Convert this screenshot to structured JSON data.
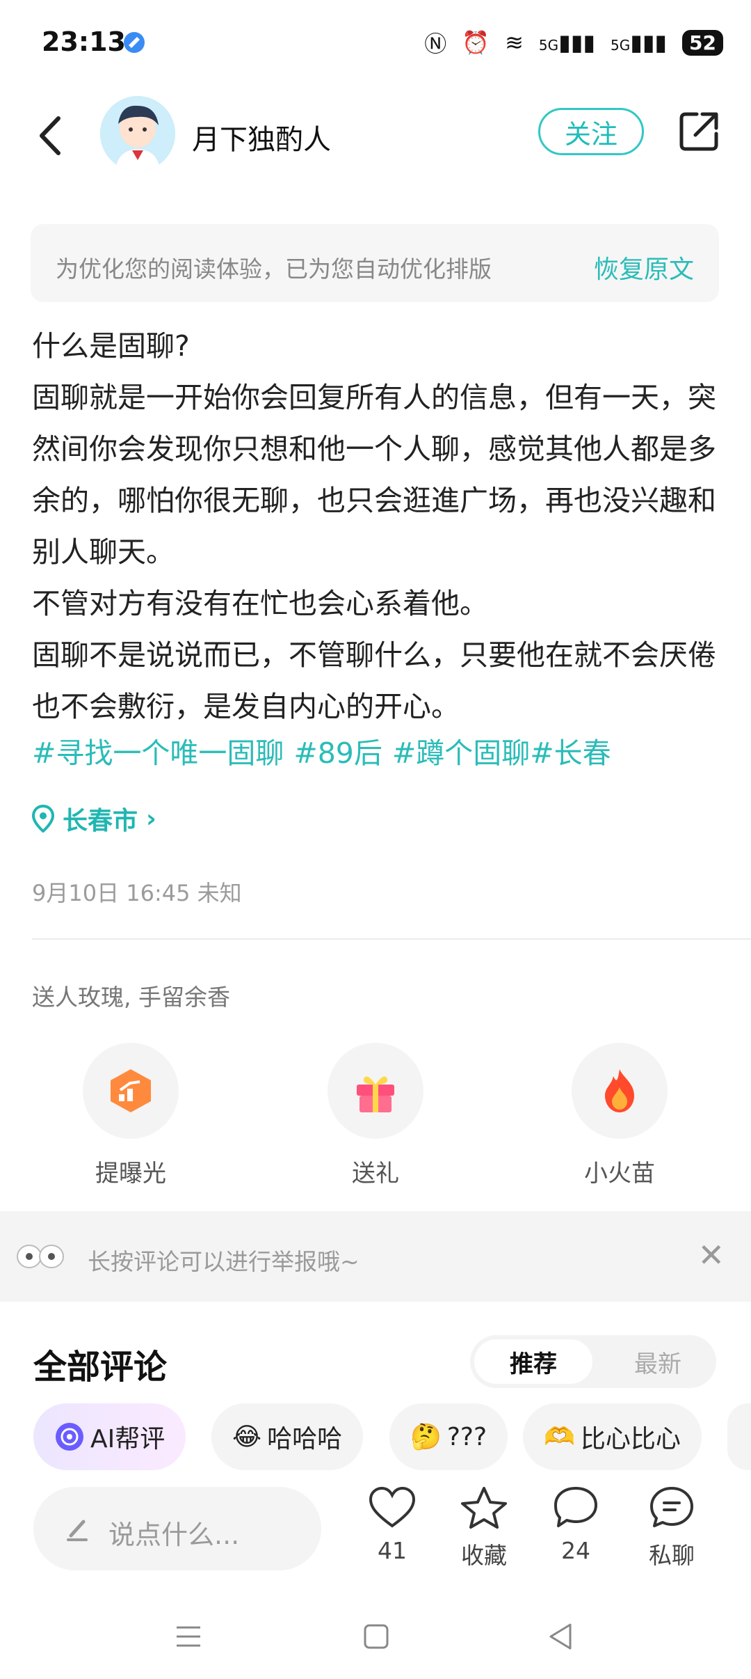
{
  "status_bar": {
    "time": "23:13",
    "signal_1": "5G",
    "signal_2": "5G",
    "battery": "52"
  },
  "header": {
    "username": "月下独酌人",
    "follow_label": "关注"
  },
  "notice": {
    "text": "为优化您的阅读体验，已为您自动优化排版",
    "restore_label": "恢复原文"
  },
  "post": {
    "paragraphs": [
      "什么是固聊?",
      "固聊就是一开始你会回复所有人的信息，但有一天，突然间你会发现你只想和他一个人聊，感觉其他人都是多余的，哪怕你很无聊，也只会逛進广场，再也没兴趣和别人聊天。",
      "不管对方有没有在忙也会心系着他。",
      "固聊不是说说而已，不管聊什么，只要他在就不会厌倦也不会敷衍，是发自内心的开心。"
    ],
    "hashtags": [
      "#寻找一个唯一固聊",
      "#89后",
      "#蹲个固聊#长春"
    ],
    "location": "长春市",
    "datetime": "9月10日 16:45 未知"
  },
  "gifts": {
    "title": "送人玫瑰, 手留余香",
    "items": [
      {
        "label": "提曝光",
        "icon": "boost-icon"
      },
      {
        "label": "送礼",
        "icon": "gift-icon"
      },
      {
        "label": "小火苗",
        "icon": "flame-icon"
      }
    ]
  },
  "tip": {
    "text": "长按评论可以进行举报哦~"
  },
  "comments": {
    "title": "全部评论",
    "sort_recommended": "推荐",
    "sort_latest": "最新"
  },
  "quick_replies": [
    {
      "label": "AI帮评"
    },
    {
      "label": "哈哈哈"
    },
    {
      "label": "???"
    },
    {
      "label": "比心比心"
    }
  ],
  "bottom_bar": {
    "input_placeholder": "说点什么...",
    "like_count": "41",
    "favorite_label": "收藏",
    "comment_count": "24",
    "message_label": "私聊"
  },
  "colors": {
    "accent": "#2bbcb8",
    "divider": "#ececec"
  }
}
